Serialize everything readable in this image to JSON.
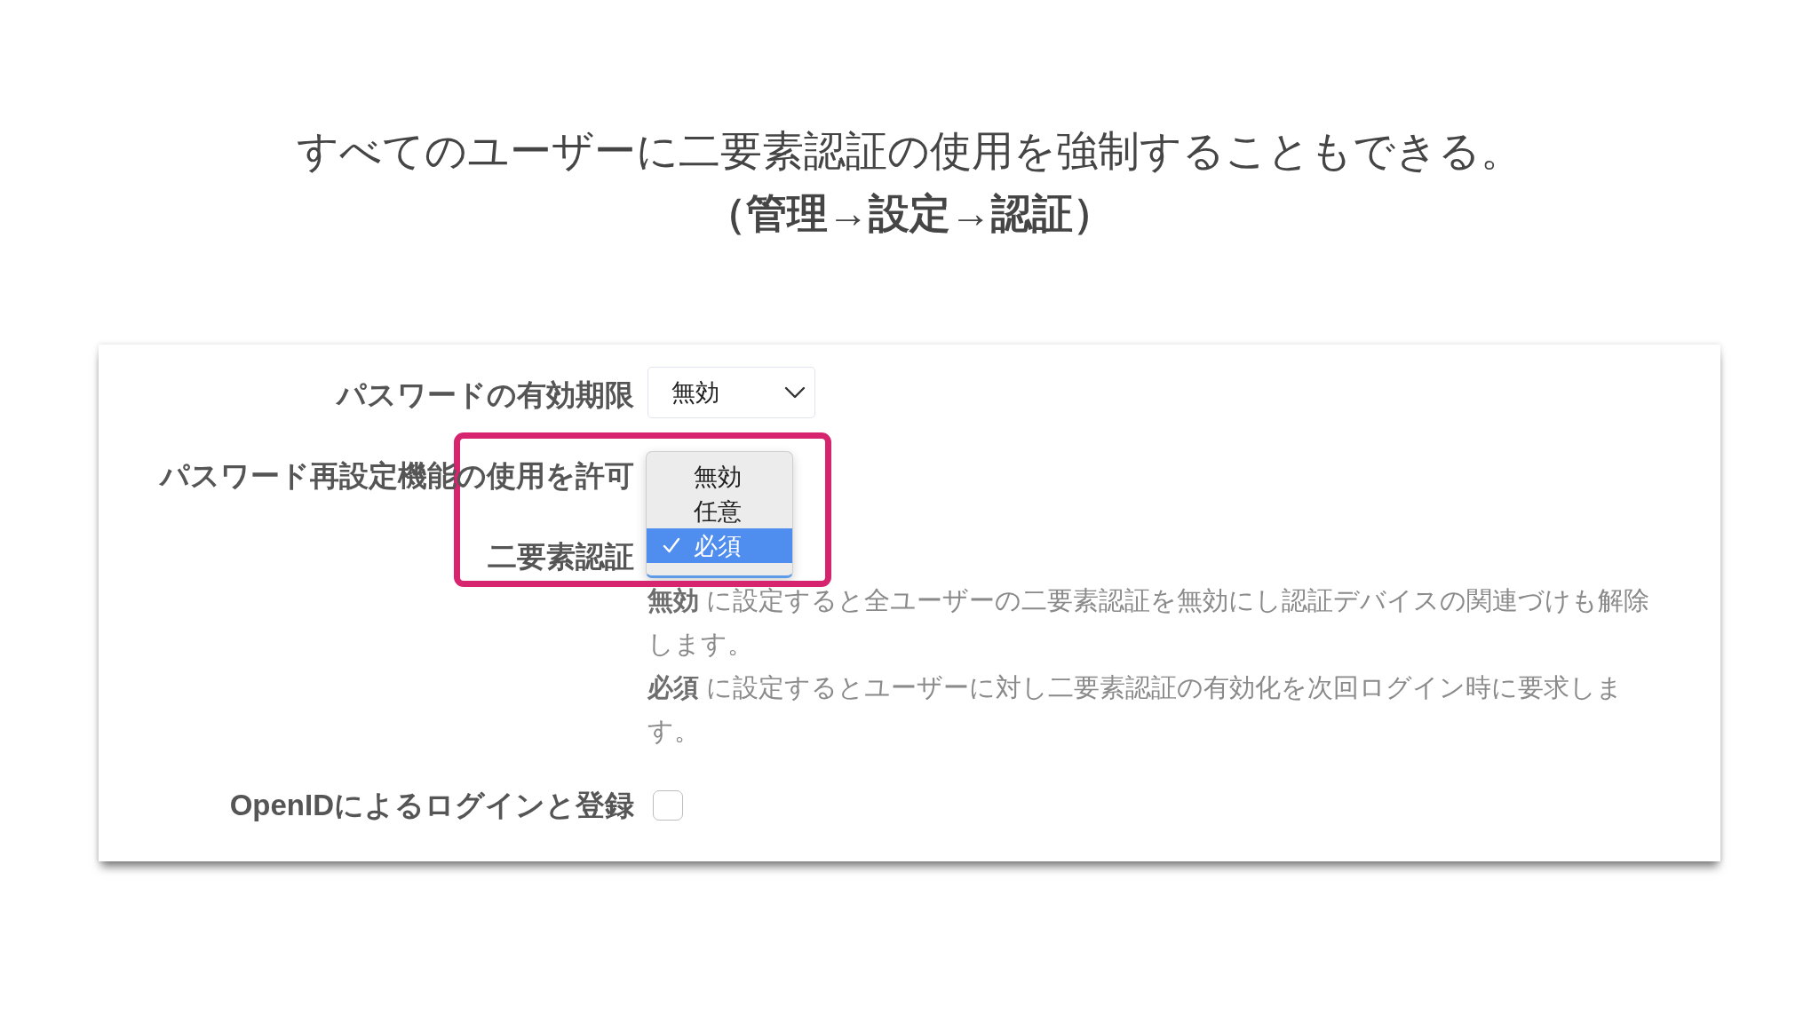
{
  "slide": {
    "title": "すべてのユーザーに二要素認証の使用を強制することもできる。",
    "subtitle": "（管理→設定→認証）"
  },
  "settings": [
    {
      "kind": "select",
      "label": "パスワードの有効期限",
      "value": "無効"
    },
    {
      "kind": "label",
      "label": "パスワード再設定機能の使用を許可"
    },
    {
      "kind": "dropdown",
      "label": "二要素認証",
      "open": true,
      "highlighted": true,
      "options": [
        {
          "label": "無効",
          "selected": false
        },
        {
          "label": "任意",
          "selected": false
        },
        {
          "label": "必須",
          "selected": true
        }
      ],
      "help": [
        "**無効** に設定すると全ユーザーの二要素認証を無効にし認証デバイスの関連づけも解除します。",
        "**必須** に設定するとユーザーに対し二要素認証の有効化を次回ログイン時に要求します。"
      ]
    },
    {
      "kind": "checkbox",
      "label": "OpenIDによるログインと登録",
      "checked": false
    }
  ]
}
